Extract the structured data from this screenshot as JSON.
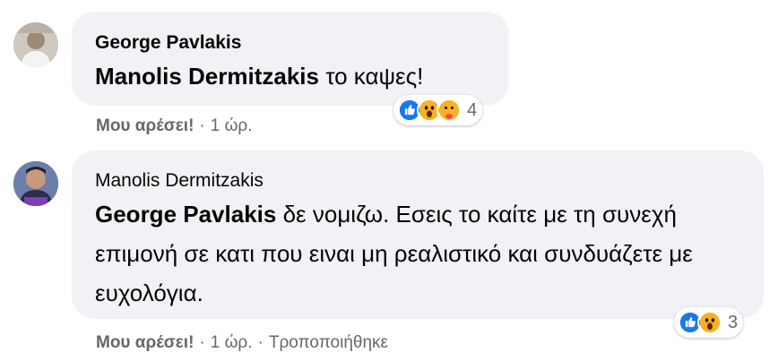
{
  "comments": [
    {
      "author": "George Pavlakis",
      "mention": "Manolis Dermitzakis",
      "text": " το καψες!",
      "reaction_count": "4",
      "reactions": [
        "like-icon",
        "wow-icon",
        "care-icon"
      ],
      "like_label": "Μου αρέσει!",
      "time": "1 ώρ."
    },
    {
      "author": "Manolis Dermitzakis",
      "mention": "George Pavlakis",
      "text": " δε νομιζω. Εσεις το καίτε με τη συνεχή επιμονή σε κατι που ειναι μη ρεαλιστικό και συνδυάζετε με ευχολόγια.",
      "reaction_count": "3",
      "reactions": [
        "like-icon",
        "wow-icon"
      ],
      "like_label": "Μου αρέσει!",
      "time": "1 ώρ.",
      "edited_label": "Τροποποιήθηκε"
    }
  ],
  "colors": {
    "bubble": "#f0f2f5",
    "like_blue": "#1877f2",
    "wow_yellow": "#f7b125",
    "secondary_text": "#65676b"
  }
}
